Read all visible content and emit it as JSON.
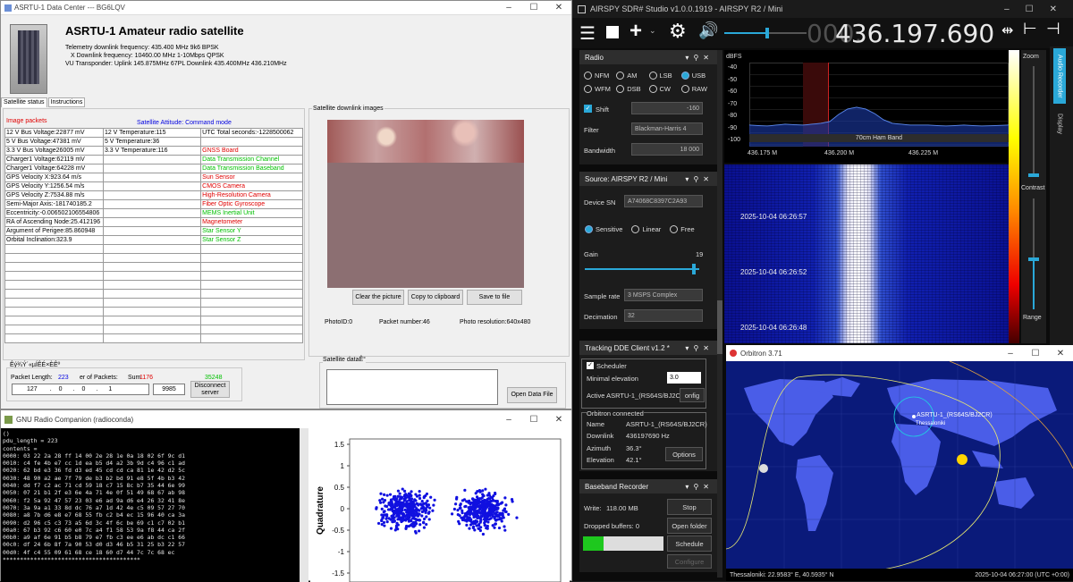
{
  "asrtu": {
    "window_title": "ASRTU-1 Data Center --- BG6LQV",
    "title": "ASRTU-1  Amateur radio satellite",
    "info_lines": [
      "Telemetry downlink frequency: 435.400 MHz 9k6 BPSK",
      "X      Downlink frequency: 10460.00 MHz 1-10Mbps QPSK",
      "VU   Transponder: Uplink 145.875MHz 67PL Downlink 435.400MHz 436.210MHz"
    ],
    "tabs": [
      "Satellite status",
      "Instructions"
    ],
    "image_packets": "Image packets",
    "attitude": "Satellite Attitude: Command mode",
    "grid": [
      [
        "12 V  Bus Voltage:22877 mV",
        "12 V Temperature:115",
        "UTC Total seconds:-1228500062"
      ],
      [
        " 5 V  Bus Voltage:47381 mV",
        " 5 V Temperature:36",
        ""
      ],
      [
        "3.3 V  Bus Voltage26005 mV",
        "3.3 V Temperature:116",
        "GNSS Board"
      ],
      [
        "Charger1 Voltage:62119 mV",
        "",
        "Data Transmission Channel"
      ],
      [
        "Charger1 Voltage:64228 mV",
        "",
        "Data Transmission Baseband"
      ],
      [
        "GPS Velocity X:923.64 m/s",
        "",
        "Sun Sensor"
      ],
      [
        "GPS Velocity Y:1256.54 m/s",
        "",
        "CMOS Camera"
      ],
      [
        "GPS Velocity Z:7534.88 m/s",
        "",
        "High-Resolution Camera"
      ],
      [
        "Semi-Major Axis:-181740185.2",
        "",
        "Fiber Optic Gyroscope"
      ],
      [
        "Eccentricity:-0.006502106554806",
        "",
        "MEMS Inertial Unit"
      ],
      [
        "RA of Ascending Node:25.412196",
        "",
        "Magnetometer"
      ],
      [
        "Argument of Perigee:85.860948",
        "",
        "Star Sensor Y"
      ],
      [
        "Orbital Inclination:323.9",
        "",
        "Star Sensor Z"
      ],
      [
        "",
        "",
        ""
      ],
      [
        "",
        "",
        ""
      ],
      [
        "",
        "",
        ""
      ],
      [
        "",
        "",
        ""
      ],
      [
        "",
        "",
        ""
      ],
      [
        "",
        "",
        ""
      ],
      [
        "",
        "",
        ""
      ],
      [
        "",
        "",
        ""
      ],
      [
        "",
        "",
        ""
      ],
      [
        "",
        "",
        ""
      ],
      [
        "",
        "",
        ""
      ]
    ],
    "grid_colors": [
      "",
      "",
      "red",
      "green",
      "green",
      "red",
      "red",
      "red",
      "red",
      "green",
      "red",
      "green",
      "green"
    ],
    "downlink_images_label": "Satellite downlink images",
    "clear_btn": "Clear the picture",
    "copy_btn": "Copy to clipboard",
    "save_btn": "Save to file",
    "photo_id": "PhotoID:0",
    "packet_number": "Packet number:46",
    "photo_res": "Photo resolution:640x480",
    "garbled": "Êý¾Ý´«µÍÊÉ×ÈÊº",
    "packet_length_label": "Packet Length:",
    "packet_length": "223",
    "num_packets_label": "er of Packets:",
    "sum_label": "Sum",
    "sum_value": "1176",
    "sum2": "35248",
    "ip": [
      "127",
      ".",
      "0",
      ".",
      "0",
      ".",
      "1"
    ],
    "port": "9985",
    "disconnect": "Disconnect server",
    "sat_data_label": "Satellite dataÊ°",
    "open_data_file": "Open Data File"
  },
  "gnu": {
    "window_title": "GNU Radio Companion (radioconda)",
    "terminal": [
      "()",
      "pdu_length = 223",
      "contents =",
      "0000: 03 22 2a 28 ff 14 00 2e 28 1e 0a 18 02 6f 9c d1",
      "0010: c4 fe 4b e7 cc 1d ea b5 d4 a2 3b 9d c4 96 c1 ad",
      "0020: 62 bd e3 36 fd d3 ed 45 cd cd ca 81 1e 42 d2 5c",
      "0030: 48 90 a2 ae 7f 79 de b3 b2 bd 91 e8 5f 4b b3 42",
      "0040: dd f7 c2 ac 71 cd 59 18 c7 15 8c b7 35 44 6e 99",
      "0050: 07 21 b1 2f e3 6e 4a 71 4e 0f 51 49 68 67 ab 98",
      "0060: f2 5a 92 47 57 23 03 e6 ad 9a d6 e4 26 32 41 8e",
      "0070: 3a 9a a1 33 8d dc 76 a7 1d 42 4e c5 09 57 27 70",
      "0080: a8 7b d6 e8 e7 68 55 fb c2 b4 ec 15 96 40 ca 3a",
      "0090: d2 96 c5 c3 73 a5 6d 3c 4f 6c be 69 c1 c7 02 b1",
      "00a0: 67 b3 92 c6 60 e0 7c a4 f1 58 53 9a f8 44 ca 2f",
      "00b0: a9 af 6e 91 b5 b8 79 e7 fb c3 ee e6 ab dc c1 66",
      "00c0: df 24 6b 8f 7a 90 53 d0 d3 46 b5 31 25 b3 22 57",
      "00d0: 4f c4 55 09 61 68 ce 18 60 d7 44 7c 7c 68 ec",
      "****************************************"
    ],
    "ylabel": "Quadrature",
    "yticks": [
      "1.5",
      "1",
      "0.5",
      "0",
      "-0.5",
      "-1",
      "-1.5"
    ]
  },
  "sdr": {
    "window_title": "AIRSPY SDR# Studio v1.0.0.1919 - AIRSPY R2 / Mini",
    "freq_dim": "000.",
    "freq": "436.197.690",
    "radio": {
      "title": "Radio",
      "modes": [
        "NFM",
        "AM",
        "LSB",
        "USB",
        "WFM",
        "DSB",
        "CW",
        "RAW"
      ],
      "selected": "USB",
      "shift_label": "Shift",
      "shift_val": "-160",
      "filter_label": "Filter",
      "filter_val": "Blackman-Harris 4",
      "bw_label": "Bandwidth",
      "bw_val": "18 000"
    },
    "source": {
      "title": "Source: AIRSPY R2 / Mini",
      "device_label": "Device SN",
      "device_val": "A74068C8397C2A93",
      "modes": [
        "Sensitive",
        "Linear",
        "Free"
      ],
      "gain_label": "Gain",
      "gain_val": "19",
      "sr_label": "Sample rate",
      "sr_val": "3 MSPS Complex",
      "dec_label": "Decimation",
      "dec_val": "32",
      "gain_level": 0.95
    },
    "spectrum": {
      "unit": "dBFS",
      "db": [
        "-40",
        "-50",
        "-60",
        "-70",
        "-80",
        "-90",
        "-100"
      ],
      "band": "70cm Ham Band",
      "freqs": [
        "436.175 M",
        "436.200 M",
        "436.225 M"
      ],
      "right_val": "13"
    },
    "waterfall": {
      "times": [
        "2025-10-04 06:26:57",
        "2025-10-04 06:26:52",
        "2025-10-04 06:26:48"
      ]
    },
    "side": {
      "zoom": "Zoom",
      "contrast": "Contrast",
      "range": "Range",
      "audio": "Audio Recorder",
      "display": "Display"
    },
    "tracking": {
      "title": "Tracking DDE Client v1.2 *",
      "scheduler": "Scheduler",
      "min_elev_label": "Minimal elevation",
      "min_elev": "3.0",
      "active": "Active ASRTU-1_(RS64S/BJ2CR)",
      "config_btn": "onfig",
      "orb_conn": "Orbitron connected",
      "name_label": "Name",
      "name": "ASRTU-1_(RS64S/BJ2CR)",
      "down_label": "Downlink",
      "down": "436197690 Hz",
      "az_label": "Azimuth",
      "az": "36.3°",
      "el_label": "Elevation",
      "el": "42.1°",
      "options": "Options"
    },
    "baseband": {
      "title": "Baseband Recorder",
      "write": "Write:",
      "write_val": "118.00 MB",
      "stop": "Stop",
      "dropped": "Dropped buffers: 0",
      "open_folder": "Open folder",
      "schedule": "Schedule",
      "configure": "Configure",
      "progress": 0.25
    }
  },
  "orbitron": {
    "title": "Orbitron 3.71",
    "sat_label": "ASRTU-1_(RS64S/BJ2CR)",
    "city": "Thessaloniki",
    "status_left": "Thessaloniki: 22.9583° E, 40.5935° N",
    "status_right": "2025-10-04 06:27:00 (UTC +0:00)"
  },
  "colors": {
    "sdr_accent": "#2aa8d8",
    "map_ocean": "#0a1a7a",
    "map_land": "#4a5de8"
  }
}
